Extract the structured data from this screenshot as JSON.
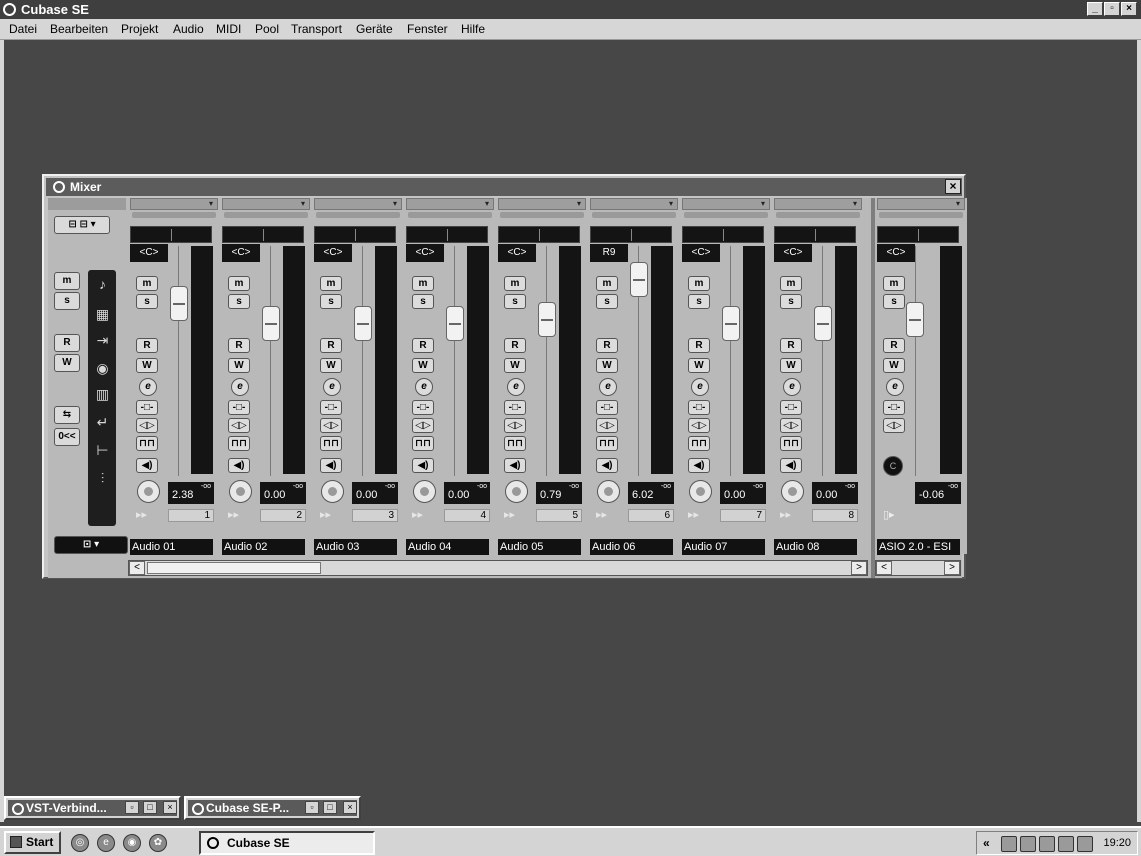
{
  "app": {
    "title": "Cubase SE"
  },
  "menu": [
    "Datei",
    "Bearbeiten",
    "Projekt",
    "Audio",
    "MIDI",
    "Pool",
    "Transport",
    "Geräte",
    "Fenster",
    "Hilfe"
  ],
  "mixer": {
    "title": "Mixer",
    "left_buttons": {
      "mute": "m",
      "solo": "s",
      "read": "R",
      "write": "W",
      "reset": "0<<"
    },
    "channels": [
      {
        "name": "Audio 01",
        "volume": "2.38",
        "peak": "-oo",
        "number": "1",
        "pan": "<C>",
        "fader_level": 0.8
      },
      {
        "name": "Audio 02",
        "volume": "0.00",
        "peak": "-oo",
        "number": "2",
        "pan": "<C>",
        "fader_level": 0.7
      },
      {
        "name": "Audio 03",
        "volume": "0.00",
        "peak": "-oo",
        "number": "3",
        "pan": "<C>",
        "fader_level": 0.7
      },
      {
        "name": "Audio 04",
        "volume": "0.00",
        "peak": "-oo",
        "number": "4",
        "pan": "<C>",
        "fader_level": 0.7
      },
      {
        "name": "Audio 05",
        "volume": "0.79",
        "peak": "-oo",
        "number": "5",
        "pan": "<C>",
        "fader_level": 0.72
      },
      {
        "name": "Audio 06",
        "volume": "6.02",
        "peak": "-oo",
        "number": "6",
        "pan": "R9",
        "fader_level": 0.92
      },
      {
        "name": "Audio 07",
        "volume": "0.00",
        "peak": "-oo",
        "number": "7",
        "pan": "<C>",
        "fader_level": 0.7
      },
      {
        "name": "Audio 08",
        "volume": "0.00",
        "peak": "-oo",
        "number": "8",
        "pan": "<C>",
        "fader_level": 0.7
      }
    ],
    "strip_buttons": {
      "m": "m",
      "s": "s",
      "r": "R",
      "w": "W",
      "e": "e"
    },
    "master": {
      "name": "ASIO 2.0 - ESI",
      "volume": "-0.06",
      "peak": "-oo",
      "pan": "<C>",
      "fader_level": 0.72,
      "knob": "C"
    }
  },
  "minimized": [
    {
      "title": "VST-Verbind..."
    },
    {
      "title": "Cubase SE-P..."
    }
  ],
  "taskbar": {
    "start": "Start",
    "task": "Cubase SE",
    "clock": "19:20",
    "tray_expand": "«"
  }
}
